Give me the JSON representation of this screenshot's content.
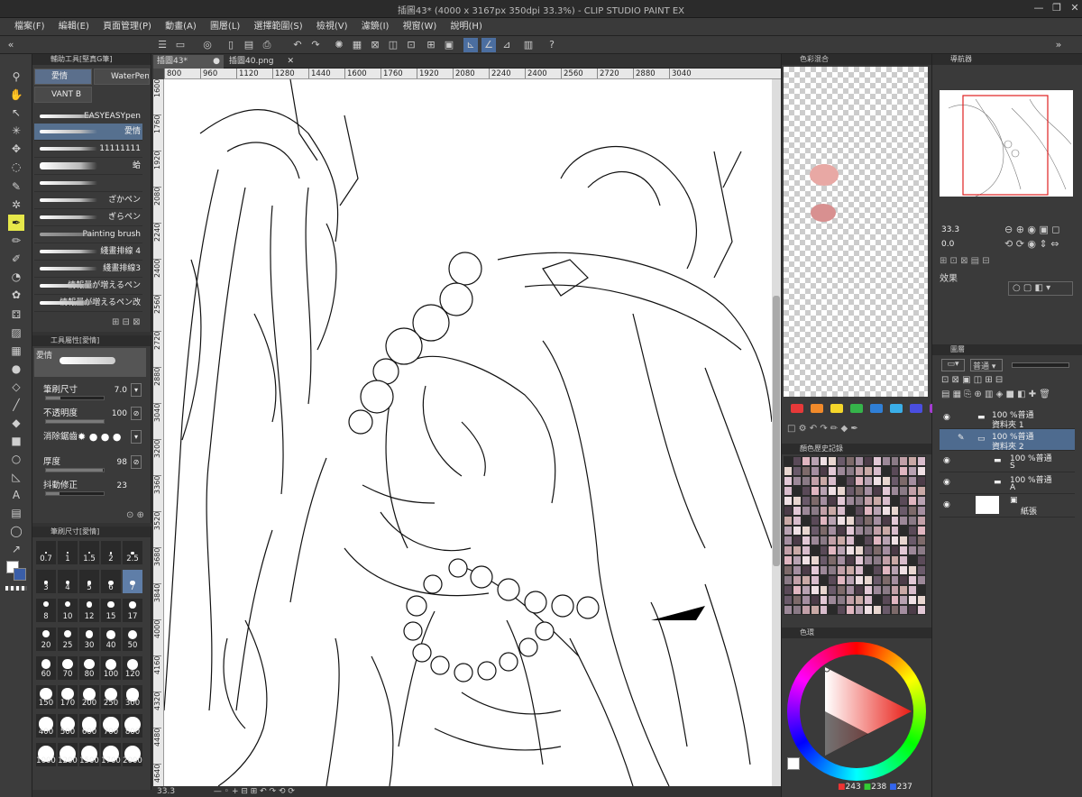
{
  "title": "插圖43* (4000 x 3167px 350dpi 33.3%)  - CLIP STUDIO PAINT EX",
  "menu": [
    "檔案(F)",
    "編輯(E)",
    "頁面管理(P)",
    "動畫(A)",
    "圖層(L)",
    "選擇範圍(S)",
    "檢視(V)",
    "濾鏡(I)",
    "視窗(W)",
    "說明(H)"
  ],
  "window_buttons": [
    "—",
    "❐",
    "✕"
  ],
  "subtool": {
    "header": "輔助工具[堅真G筆]",
    "tabs": [
      "愛情",
      "WaterPenc",
      "VANT B"
    ],
    "brushes": [
      "EASYEASYpen",
      "愛情",
      "11111111",
      "蛤",
      "",
      "ざかペン",
      "ぎらペン",
      "Painting brush",
      "綫畫排線 4",
      "綫畫排線3",
      "情報量が増えるペン",
      "情報量が増えるペン改"
    ]
  },
  "toolprop": {
    "header": "工具屬性[愛情]",
    "preview_label": "愛情",
    "rows": [
      {
        "label": "筆刷尺寸",
        "value": "7.0",
        "level": 0.25
      },
      {
        "label": "不透明度",
        "value": "100",
        "level": 1.0
      },
      {
        "label": "消除鋸齒",
        "value": "",
        "level": 0
      },
      {
        "label": "厚度",
        "value": "98",
        "level": 0.98
      },
      {
        "label": "抖動修正",
        "value": "23",
        "level": 0.23
      }
    ]
  },
  "brushsize": {
    "header": "筆刷尺寸[愛情]",
    "sizes": [
      "0.7",
      "1",
      "1.5",
      "2",
      "2.5",
      "3",
      "4",
      "5",
      "6",
      "7",
      "8",
      "10",
      "12",
      "15",
      "17",
      "20",
      "25",
      "30",
      "40",
      "50",
      "60",
      "70",
      "80",
      "100",
      "120",
      "150",
      "170",
      "200",
      "250",
      "300",
      "400",
      "500",
      "600",
      "700",
      "800",
      "1000",
      "1200",
      "1500",
      "1700",
      "2000"
    ],
    "selected": "7"
  },
  "canvas": {
    "tabs": [
      "插圖43*",
      "插圖40.png"
    ],
    "ruler_h": [
      "800",
      "960",
      "1120",
      "1280",
      "1440",
      "1600",
      "1760",
      "1920",
      "2080",
      "2240",
      "2400",
      "2560",
      "2720",
      "2880",
      "3040"
    ],
    "ruler_v": [
      "1600",
      "1760",
      "1920",
      "2080",
      "2240",
      "2400",
      "2560",
      "2720",
      "2880",
      "3040",
      "3200",
      "3360",
      "3520",
      "3680",
      "3840",
      "4000",
      "4160",
      "4320",
      "4480",
      "4640"
    ],
    "zoom": "33.3"
  },
  "colormix": {
    "header": "色彩混合"
  },
  "colorset": {
    "colors": [
      "#e63939",
      "#f18a2a",
      "#f5d62a",
      "#35b44a",
      "#2f7fd6",
      "#3aaee8",
      "#4a4ee0",
      "#a43cd2"
    ]
  },
  "history": {
    "header": "顏色歷史記錄"
  },
  "colorwheel": {
    "header": "色環",
    "rgb": [
      "243",
      "238",
      "237"
    ]
  },
  "navigator": {
    "header": "導航器",
    "zoom": "33.3",
    "angle": "0.0"
  },
  "effects": {
    "header": "效果"
  },
  "layers": {
    "header": "圖層",
    "blend": "普通",
    "items": [
      {
        "opacity": "100 %普通",
        "name": "資料夾 1"
      },
      {
        "opacity": "100 %普通",
        "name": "資料夾 2"
      },
      {
        "opacity": "100 %普通",
        "name": "S"
      },
      {
        "opacity": "100 %普通",
        "name": "A"
      },
      {
        "opacity": "",
        "name": "紙張"
      }
    ]
  }
}
